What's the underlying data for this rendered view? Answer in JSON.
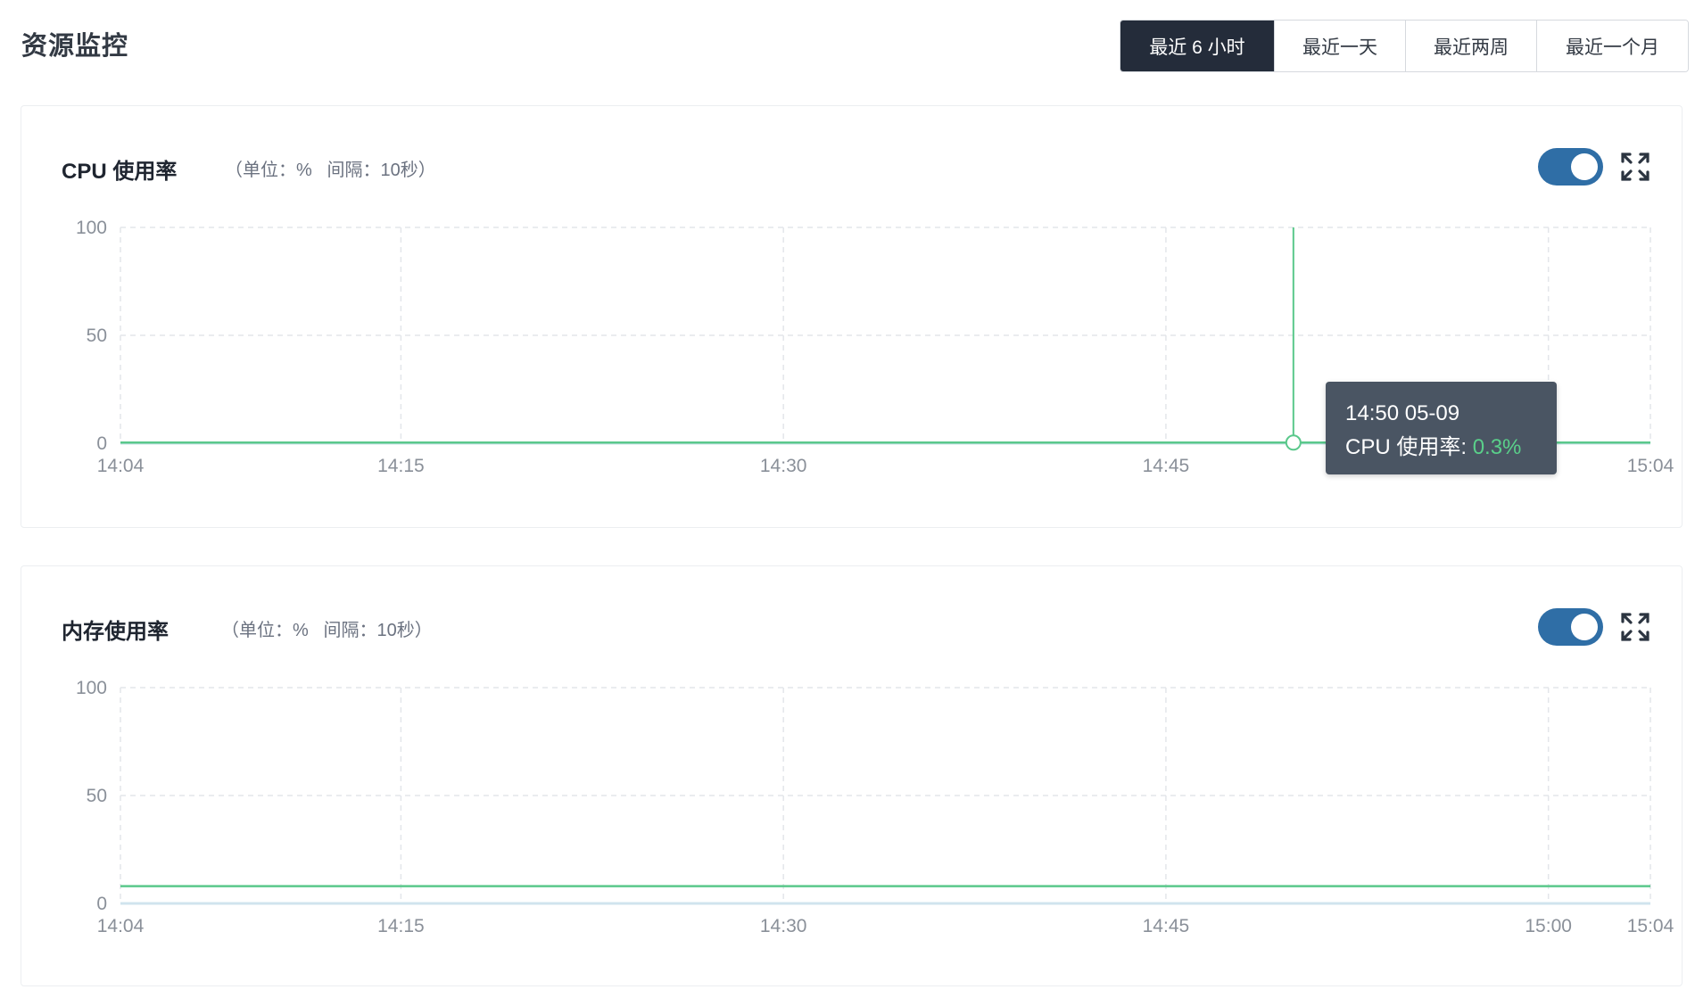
{
  "page": {
    "title": "资源监控"
  },
  "time_range": {
    "options": [
      "最近 6 小时",
      "最近一天",
      "最近两周",
      "最近一个月"
    ],
    "selected": "最近 6 小时"
  },
  "colors": {
    "accent": "#242c3a",
    "toggle": "#2f6ea6",
    "line": "#5ac88b",
    "tooltip_bg": "#4a5563",
    "tooltip_value": "#5ad08a"
  },
  "cpu_card": {
    "title": "CPU 使用率",
    "meta": "（单位：%   间隔：10秒）",
    "toggle_on": true,
    "tooltip": {
      "time": "14:50 05-09",
      "label": "CPU 使用率: ",
      "value": "0.3%"
    }
  },
  "mem_card": {
    "title": "内存使用率",
    "meta": "（单位：%   间隔：10秒）",
    "toggle_on": true
  },
  "chart_data": [
    {
      "type": "line",
      "title": "CPU 使用率",
      "y_ticks": [
        "100",
        "50",
        "0"
      ],
      "ylim": [
        0,
        100
      ],
      "x_ticks": [
        "14:04",
        "14:15",
        "14:30",
        "14:45",
        "15:04"
      ],
      "x": [
        "14:04",
        "14:15",
        "14:30",
        "14:45",
        "14:50",
        "15:00",
        "15:04"
      ],
      "series": [
        {
          "values": [
            0.3,
            0.3,
            0.3,
            0.3,
            0.3,
            0.3,
            0.3
          ]
        }
      ],
      "grid": true,
      "crosshair_x": "14:50"
    },
    {
      "type": "line",
      "title": "内存使用率",
      "y_ticks": [
        "100",
        "50",
        "0"
      ],
      "ylim": [
        0,
        100
      ],
      "x_ticks": [
        "14:04",
        "14:15",
        "14:30",
        "14:45",
        "15:00",
        "15:04"
      ],
      "x": [
        "14:04",
        "14:15",
        "14:30",
        "14:45",
        "15:00",
        "15:04"
      ],
      "series": [
        {
          "values": [
            8,
            8,
            8,
            8,
            8,
            8
          ]
        }
      ],
      "grid": true
    }
  ]
}
